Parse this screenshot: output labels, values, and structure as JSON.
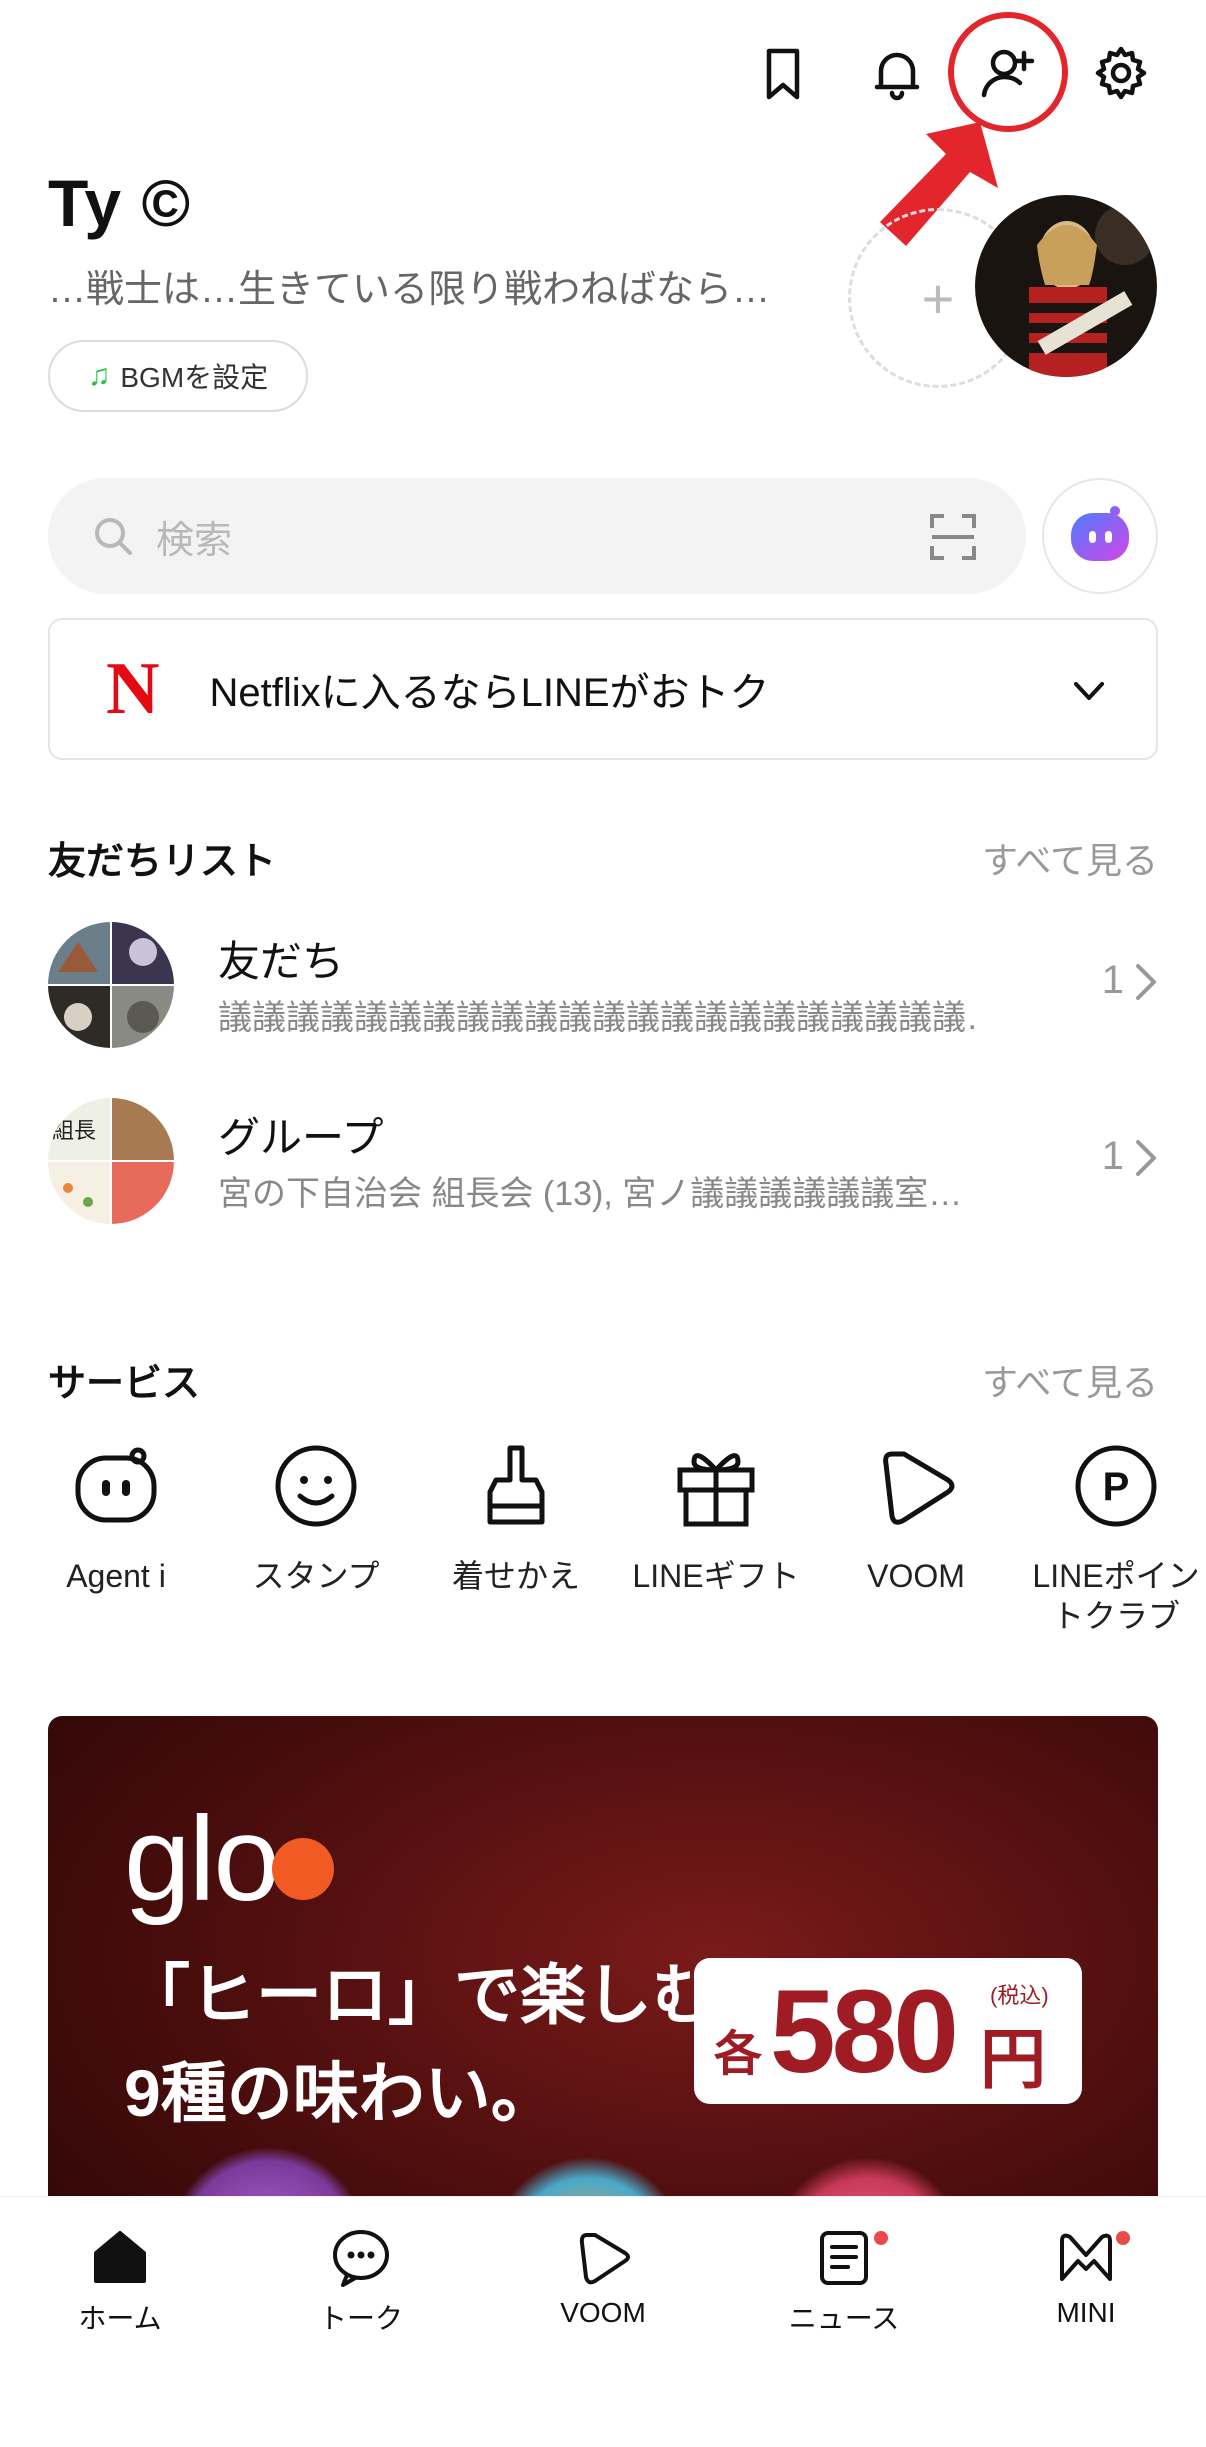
{
  "header": {
    "icons": [
      "bookmark-icon",
      "bell-icon",
      "add-friend-icon",
      "gear-icon"
    ],
    "highlight_color": "#e3262b"
  },
  "profile": {
    "name": "Ty ©",
    "status": "…戦士は…生きている限り戦わねばなら…",
    "bgm_label": "BGMを設定",
    "add_story_symbol": "+"
  },
  "search": {
    "placeholder": "検索"
  },
  "promo": {
    "logo": "N",
    "text": "Netflixに入るならLINEがおトク"
  },
  "friends_section": {
    "title": "友だちリスト",
    "see_all": "すべて見る",
    "rows": [
      {
        "name": "友だち",
        "subtitle": "議議議議議議議議議議議議議議議議議議議議議議…",
        "count": "1"
      },
      {
        "name": "グループ",
        "subtitle": "宮の下自治会 組長会 (13), 宮ノ議議議議議議室…",
        "count": "1"
      }
    ]
  },
  "services_section": {
    "title": "サービス",
    "see_all": "すべて見る",
    "items": [
      {
        "label": "Agent i",
        "icon": "agent-icon"
      },
      {
        "label": "スタンプ",
        "icon": "smile-icon"
      },
      {
        "label": "着せかえ",
        "icon": "brush-icon"
      },
      {
        "label": "LINEギフト",
        "icon": "gift-icon"
      },
      {
        "label": "VOOM",
        "icon": "voom-icon"
      },
      {
        "label": "LINEポイン\nトクラブ",
        "icon": "points-icon"
      }
    ]
  },
  "ad": {
    "brand": "glo",
    "catch_line1": "「ヒーロ」で楽しむ、",
    "catch_line2": "9種の味わい。",
    "each": "各",
    "price": "580",
    "yen": "円",
    "tax": "(税込)",
    "brand_color": "#f15a22"
  },
  "tabbar": {
    "tabs": [
      {
        "label": "ホーム",
        "icon": "home-icon",
        "active": true
      },
      {
        "label": "トーク",
        "icon": "chat-icon"
      },
      {
        "label": "VOOM",
        "icon": "voom-icon"
      },
      {
        "label": "ニュース",
        "icon": "news-icon",
        "badge": true
      },
      {
        "label": "MINI",
        "icon": "mini-icon",
        "badge": true
      }
    ]
  }
}
